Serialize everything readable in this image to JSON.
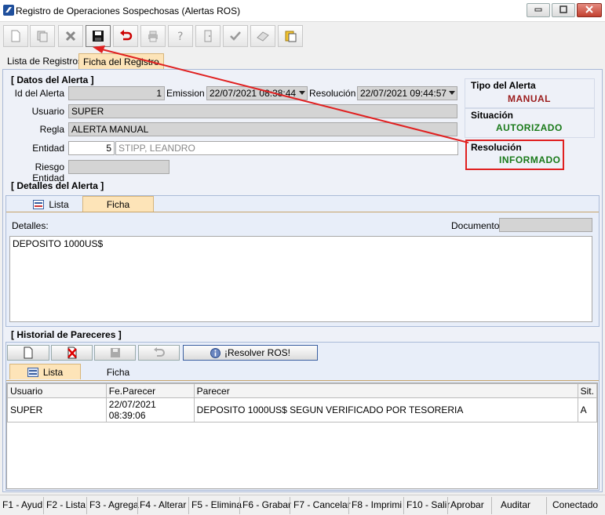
{
  "window": {
    "title": "Registro de Operaciones Sospechosas (Alertas ROS)",
    "minimize": "▭",
    "maximize": "▢",
    "close": "✕"
  },
  "toolbar": {
    "icons": [
      "new-document-icon",
      "copy-document-icon",
      "delete-icon",
      "save-icon",
      "undo-icon",
      "print-icon",
      "help-icon",
      "door-exit-icon",
      "check-icon",
      "eraser-icon",
      "notes-icon"
    ]
  },
  "tabs": {
    "list": "Lista de Registros",
    "record": "Ficha del Registro"
  },
  "datos": {
    "title": "[ Datos del Alerta ]",
    "id_label": "Id del Alerta",
    "id_value": "1",
    "emission_label": "Emission",
    "emission_value": "22/07/2021 08:38:44",
    "resolucion_label": "Resolución",
    "resolucion_value": "22/07/2021 09:44:57",
    "usuario_label": "Usuario",
    "usuario_value": "SUPER",
    "regla_label": "Regla",
    "regla_value": "ALERTA MANUAL",
    "entidad_label": "Entidad",
    "entidad_code": "5",
    "entidad_name": "STIPP, LEANDRO",
    "riesgo_label": "Riesgo Entidad",
    "riesgo_value": ""
  },
  "status": {
    "tipo_label": "Tipo del Alerta",
    "tipo_value": "MANUAL",
    "situacion_label": "Situación",
    "situacion_value": "AUTORIZADO",
    "resolucion_label": "Resolución",
    "resolucion_value": "INFORMADO",
    "colors": {
      "manual": "#9b1c1c",
      "ok": "#1a7a1a",
      "highlight": "#e02020",
      "arrow": "#e02020"
    }
  },
  "detalles": {
    "title": "[ Detalles del Alerta ]",
    "tab_list": "Lista",
    "tab_ficha": "Ficha",
    "detalles_label": "Detalles:",
    "documento_label": "Documento",
    "documento_value": "",
    "text": "DEPOSITO 1000US$"
  },
  "historial": {
    "title": "[ Historial de Pareceres ]",
    "resolver_label": "¡Resolver ROS!",
    "tab_list": "Lista",
    "tab_ficha": "Ficha",
    "columns": [
      "Usuario",
      "Fe.Parecer",
      "Parecer",
      "Sit."
    ],
    "rows": [
      [
        "SUPER",
        "22/07/2021 08:39:06",
        "DEPOSITO 1000US$ SEGUN VERIFICADO POR TESORERIA",
        "A"
      ]
    ]
  },
  "statusbar": {
    "items": [
      "F1 - Ayud",
      "F2 - Lista",
      "F3 - Agrega",
      "F4 - Alterar",
      "F5 - Elimina",
      "F6 - Grabar",
      "F7 - Cancelar",
      "F8 - Imprimi",
      "F10 - Salir",
      "Aprobar",
      "Auditar",
      "Conectado"
    ]
  }
}
